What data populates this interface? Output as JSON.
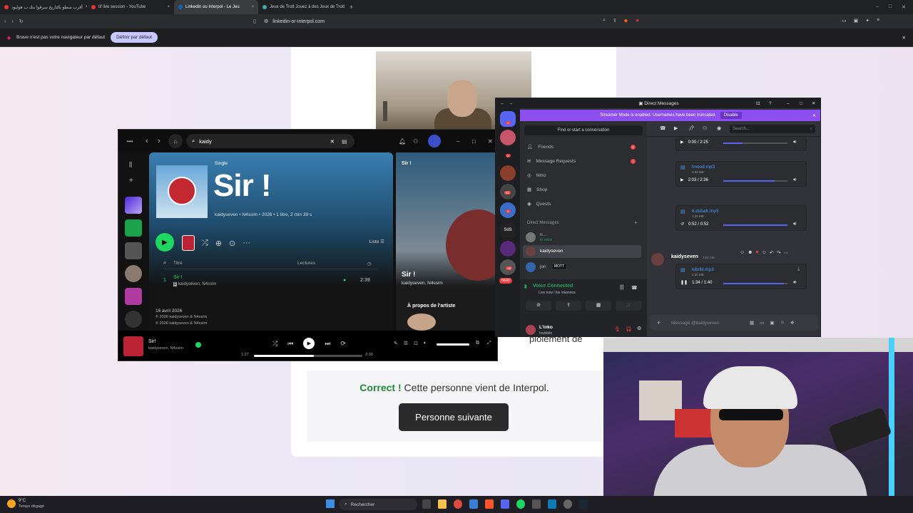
{
  "browser": {
    "tabs": [
      {
        "title": "أقرب سطو بالتاريخ سرقوا بنك ب هوليود",
        "active": false
      },
      {
        "title": "tif live session - YouTube",
        "active": false
      },
      {
        "title": "Linkedin ou Interpol - Le Jeu",
        "active": true
      },
      {
        "title": "Jeux de Trott Jouez à des Jeux de Trott",
        "active": false
      }
    ],
    "url": "linkedin-or-interpol.com",
    "infobar_text": "Brave n'est pas votre navigateur par défaut",
    "infobar_button": "Définir par défaut"
  },
  "game": {
    "correct_label": "Correct !",
    "correct_text": "Cette personne vient de Interpol.",
    "next_button": "Personne suivante",
    "partial_text": "ploiement de"
  },
  "spotify": {
    "search_value": "kaidy",
    "type_label": "Single",
    "title": "Sir !",
    "meta": "kaidyseven • N4ssim • 2026 • 1 titre, 2 min 39 s",
    "list_label": "Liste",
    "col_title": "Titre",
    "col_plays": "Lectures",
    "track_num": "1",
    "track_name": "Sir !",
    "track_artists": "kaidyseven, N4ssim",
    "track_duration": "2:39",
    "release_date": "16 avril 2026",
    "copyright1": "© 2026 kaidyseven & N4ssim",
    "copyright2": "℗ 2026 kaidyseven & N4ssim",
    "right_label": "Sir !",
    "right_title": "Sir !",
    "right_artists": "kaidyseven, N4ssim",
    "about_artist": "À propos de l'artiste",
    "now_title": "Sir!",
    "now_artists": "kaidyseven, N4ssim",
    "elapsed": "1:27",
    "total": "2:39",
    "progress": 0.55,
    "accent": "#1ed760"
  },
  "discord": {
    "window_title": "Direct Messages",
    "banner_text": "Streamer Mode is enabled. Usernames have been truncated.",
    "banner_button": "Disable",
    "find_label": "Find or start a conversation",
    "search_placeholder": "Search...",
    "menu": [
      {
        "label": "Friends",
        "badge": "6"
      },
      {
        "label": "Message Requests",
        "badge": "1"
      },
      {
        "label": "Nitro",
        "badge": ""
      },
      {
        "label": "Shop",
        "badge": ""
      },
      {
        "label": "Quests",
        "badge": ""
      }
    ],
    "dm_header": "Direct Messages",
    "dm_users": [
      {
        "name": "n...",
        "status": "In voice"
      },
      {
        "name": "kaidyseven",
        "status": ""
      },
      {
        "name": "jon",
        "status": "MOTT"
      }
    ],
    "voice_status": "Voice Connected",
    "voice_sub": "Live now / los inkonnos",
    "me_name": "L'inko",
    "me_status": "Invisible",
    "attachments": [
      {
        "file": "",
        "size": "",
        "time": "0:00 / 2:25",
        "progress": 0.3
      },
      {
        "file": "lmood.mp3",
        "size": "3.59 MB",
        "time": "2:03 / 2:36",
        "progress": 0.8
      },
      {
        "file": "6.dsbah.mp3",
        "size": "1.20 MB",
        "time": "0:52 / 0:52",
        "progress": 1.0
      },
      {
        "file": "kibriiii.mp3",
        "size": "2.30 MB",
        "time": "1:34 / 1:40",
        "progress": 0.94
      }
    ],
    "msg_author": "kaidyseven",
    "msg_time": "3:58 AM",
    "input_placeholder": "Message @kaidyseven",
    "new_badge": "NEW",
    "server_badges": [
      "4",
      "1",
      "53",
      "4",
      "19"
    ],
    "brand": "#5865f2"
  },
  "taskbar": {
    "weather_temp": "9°C",
    "weather_desc": "Temps dégagé",
    "search_label": "Rechercher"
  }
}
